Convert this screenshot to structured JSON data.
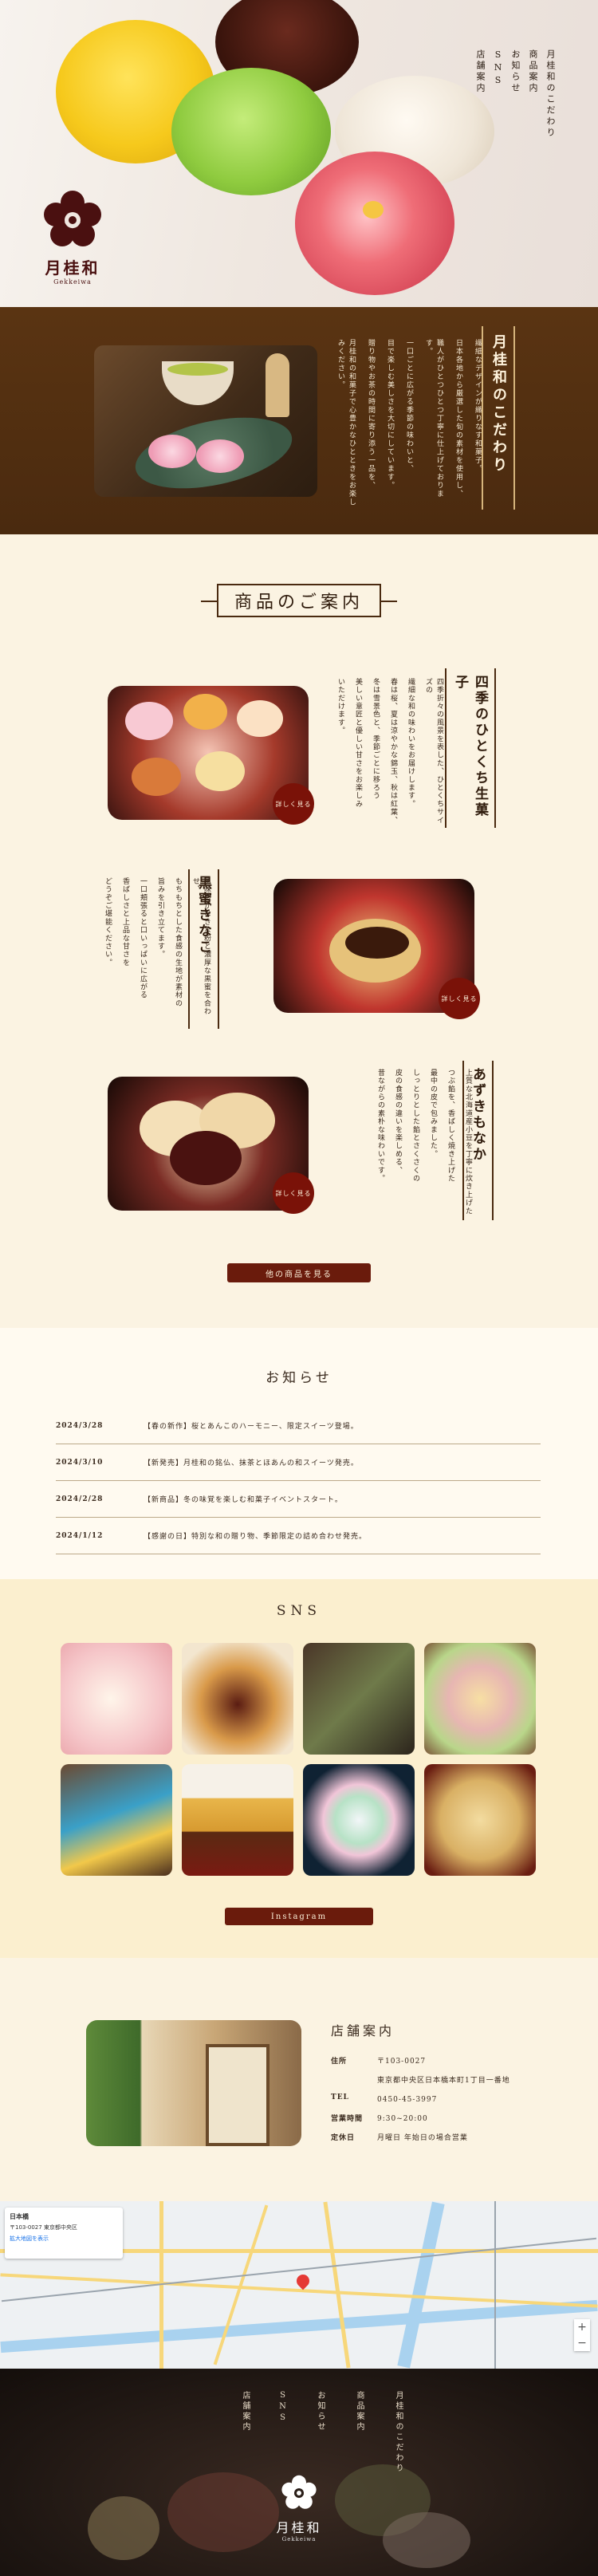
{
  "hero": {
    "nav": [
      "月桂和のこだわり",
      "商品案内",
      "お知らせ",
      "SNS",
      "店舗案内"
    ],
    "logo_name": "月桂和",
    "logo_roman": "Gekkeiwa"
  },
  "kodawari": {
    "title": "月桂和のこだわり",
    "lines": [
      "繊細なデザインが織りなす和菓子。",
      "日本各地から厳選した旬の素材を使用し、",
      "職人がひとつひとつ丁寧に仕上げております。",
      "一口ごとに広がる季節の味わいと、",
      "目で楽しむ美しさを大切にしています。",
      "贈り物やお茶の時間に寄り添う一品を、",
      "月桂和の和菓子で心豊かなひとときをお楽しみください。"
    ]
  },
  "products": {
    "heading": "商品のご案内",
    "items": [
      {
        "title": "四季のひとくち生菓子",
        "lines": [
          "四季折々の風景を表した、ひとくちサイズの",
          "繊細な和の味わいをお届けします。",
          "春は桜、夏は涼やかな錦玉、秋は紅葉、",
          "冬は雪景色と、季節ごとに移ろう",
          "美しい意匠と優しい甘さをお楽しみ",
          "いただけます。"
        ],
        "more": "詳しく見る"
      },
      {
        "title": "黒蜜きなこ",
        "lines": [
          "風味豊かなきな粉と濃厚な黒蜜を合わせ、",
          "もちもちとした食感の生地が素材の",
          "旨みを引き立てます。",
          "一口頬張ると口いっぱいに広がる",
          "香ばしさと上品な甘さを",
          "どうぞご堪能ください。"
        ],
        "more": "詳しく見る"
      },
      {
        "title": "あずきもなか",
        "lines": [
          "上質な北海道産小豆を丁寧に炊き上げた",
          "つぶ餡を、香ばしく焼き上げた",
          "最中の皮で包みました。",
          "しっとりとした餡とさくさくの",
          "皮の食感の違いを楽しめる、",
          "昔ながらの素朴な味わいです。"
        ],
        "more": "詳しく見る"
      }
    ],
    "all_button": "他の商品を見る"
  },
  "news": {
    "heading": "お知らせ",
    "items": [
      {
        "date": "2024/3/28",
        "text": "【春の新作】桜とあんこのハーモニー、限定スイーツ登場。"
      },
      {
        "date": "2024/3/10",
        "text": "【新発売】月桂和の銘仏、抹茶とほあんの和スイーツ発売。"
      },
      {
        "date": "2024/2/28",
        "text": "【新商品】冬の味覚を楽しむ和菓子イベントスタート。"
      },
      {
        "date": "2024/1/12",
        "text": "【感謝の日】特別な和の贈り物、季節限定の詰め合わせ発売。"
      }
    ]
  },
  "sns": {
    "heading": "SNS",
    "button": "Instagram"
  },
  "store": {
    "heading": "店舗案内",
    "rows": [
      {
        "label": "住所",
        "value": "〒103-0027"
      },
      {
        "label": "",
        "value": "東京都中央区日本橋本町1丁目一番地"
      },
      {
        "label": "TEL",
        "value": "0450-45-3997"
      },
      {
        "label": "営業時間",
        "value": "9:30~20:00"
      },
      {
        "label": "定休日",
        "value": "月曜日 年始日の場合営業"
      }
    ]
  },
  "map": {
    "card_title": "日本橋",
    "card_address": "〒103-0027 東京都中央区",
    "card_link": "拡大地図を表示",
    "zoom_in": "+",
    "zoom_out": "−"
  },
  "footer": {
    "nav": [
      "月桂和のこだわり",
      "商品案内",
      "お知らせ",
      "SNS",
      "店舗案内"
    ],
    "logo_name": "月桂和",
    "logo_roman": "Gekkeiwa"
  },
  "colors": {
    "brown": "#4a2a0f",
    "accent": "#6a1b0c",
    "cream": "#fbf3e2",
    "sns_bg": "#fbefcf"
  }
}
